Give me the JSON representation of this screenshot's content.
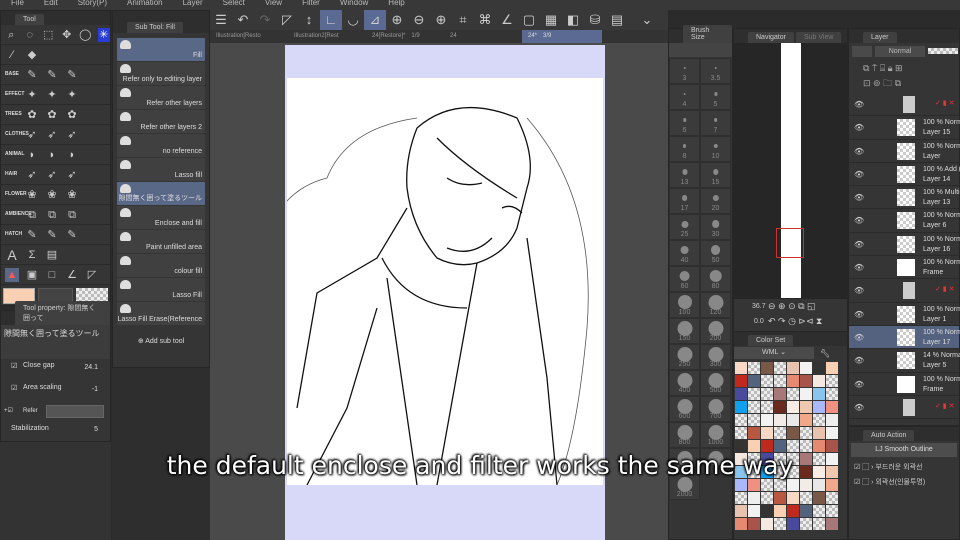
{
  "menu": [
    "File",
    "Edit",
    "Story(P)",
    "Animation",
    "Layer",
    "Select",
    "View",
    "Filter",
    "Window",
    "Help"
  ],
  "tool_panel": {
    "tab": "Tool",
    "categories": [
      "BASE",
      "EFFECT",
      "TREES",
      "CLOTHES",
      "ANIMAL",
      "HAIR",
      "FLOWER",
      "AMBIENCE",
      "HATCH"
    ],
    "accent": "#2a3cd8"
  },
  "sub_tool": {
    "tab": "Sub Tool: Fill",
    "items": [
      "Fill",
      "Refer only to editing layer",
      "Refer other layers",
      "Refer other layers 2",
      "no reference",
      "Lasso fill",
      "隙間無く囲って塗るツール",
      "Enclose and fill",
      "Paint unfilled area",
      "colour fill",
      "Lasso Fill",
      "Lasso Fill Erase(Reference"
    ],
    "selected": 6,
    "add_label": "Add sub tool"
  },
  "tool_property": {
    "tab": "Tool property: 隙間無く囲って",
    "name": "隙間無く囲って塗るツール",
    "close_gap": {
      "label": "Close gap",
      "value": "24.1"
    },
    "area_scaling": {
      "label": "Area scaling",
      "value": "-1"
    },
    "refer": "Refer",
    "stabilization": {
      "label": "Stabilization",
      "value": "5"
    }
  },
  "colors": {
    "main": "#f9d0b4",
    "selection": "#5a6888"
  },
  "canvas_tabs": [
    {
      "label": "Illustration[Resto"
    },
    {
      "label": "Illustration2[Rest"
    },
    {
      "label": "24[Restore]*",
      "page": "1/9"
    },
    {
      "label": "24"
    },
    {
      "label": "24*",
      "page": "3/9",
      "active": true
    }
  ],
  "brush_size": {
    "tab": "Brush Size",
    "sizes": [
      "3",
      "3.5",
      "4",
      "5",
      "6",
      "7",
      "8",
      "10",
      "13",
      "15",
      "17",
      "20",
      "25",
      "30",
      "40",
      "50",
      "60",
      "80",
      "100",
      "120",
      "150",
      "200",
      "250",
      "300",
      "400",
      "500",
      "600",
      "700",
      "800",
      "1000",
      "1500",
      "",
      "2000"
    ]
  },
  "navigator": {
    "tab": "Navigator",
    "tab2": "Sub View",
    "zoom": "36.7",
    "rotation": "0.0"
  },
  "color_set": {
    "tab": "Color Set",
    "set_name": "WML"
  },
  "layer": {
    "tab": "Layer",
    "blend": "Normal",
    "rows": [
      {
        "type": "folder"
      },
      {
        "t1": "100 % Normal",
        "t2": "Layer 15"
      },
      {
        "t1": "100 % Normal",
        "t2": "Layer"
      },
      {
        "t1": "100 % Add (Glow)",
        "t2": "Layer 14"
      },
      {
        "t1": "100 % Multiply",
        "t2": "Layer 13"
      },
      {
        "t1": "100 % Normal",
        "t2": "Layer 6"
      },
      {
        "t1": "100 % Normal",
        "t2": "Layer 16"
      },
      {
        "t1": "100 % Normal",
        "t2": "Frame",
        "white": true
      },
      {
        "type": "folder"
      },
      {
        "t1": "100 % Normal",
        "t2": "Layer 1"
      },
      {
        "t1": "100 % Normal",
        "t2": "Layer 17",
        "selected": true
      },
      {
        "t1": "14 % Normal",
        "t2": "Layer 5"
      },
      {
        "t1": "100 % Normal",
        "t2": "Frame",
        "white": true
      },
      {
        "type": "folder"
      }
    ]
  },
  "auto_action": {
    "tab": "Auto Action",
    "set": "LJ Smooth Outline",
    "items": [
      "부드러운 외곽선",
      "외곽선(인물투명)"
    ]
  },
  "subtitle": "the default enclose and filter works the same way"
}
